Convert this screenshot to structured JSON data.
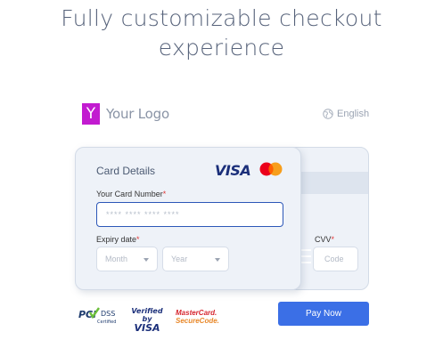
{
  "headline": "Fully customizable checkout experience",
  "logo": {
    "mark": "Y",
    "text": "Your Logo",
    "color": "#c21bd0"
  },
  "language": {
    "icon": "globe-icon",
    "label": "English"
  },
  "card": {
    "title": "Card Details",
    "brands": [
      "VISA",
      "mastercard"
    ],
    "number_label": "Your Card Number",
    "number_placeholder": "**** **** **** ****",
    "expiry_label": "Expiry date",
    "month_placeholder": "Month",
    "year_placeholder": "Year",
    "cvv_label": "CVV",
    "cvv_placeholder": "Code",
    "required_mark": "*"
  },
  "badges": {
    "pci_line1": "PCI",
    "pci_line2": "DSS",
    "pci_line3": "Certified",
    "vbv_line1": "Verified by",
    "vbv_line2": "VISA",
    "mc_line1": "MasterCard.",
    "mc_line2": "SecureCode."
  },
  "pay_button": {
    "label": "Pay Now",
    "color": "#3b6fe6"
  }
}
